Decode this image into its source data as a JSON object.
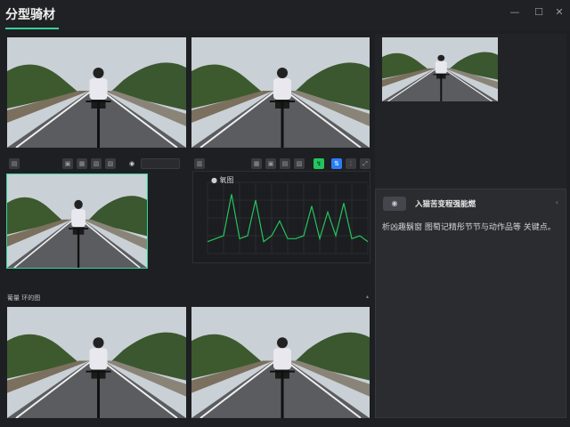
{
  "window": {
    "title": "分型骑材",
    "controls": {
      "minimize": "—",
      "maximize": "☐",
      "close": "✕"
    }
  },
  "toolbar_left": {
    "icons": [
      "save-icon",
      "adjust-icon",
      "crop-icon",
      "flip-icon",
      "rotate-icon"
    ],
    "eye_icon": "eye-icon"
  },
  "toolbar_right": {
    "icons": [
      "tag-icon",
      "grid-icon",
      "crop-icon",
      "image-icon",
      "layers-icon"
    ],
    "active_green": "↯",
    "active_blue": "⇅"
  },
  "chart": {
    "label": "● 氧图"
  },
  "chart_data": {
    "type": "line",
    "title": "",
    "xlabel": "",
    "ylabel": "",
    "x": [
      0,
      0.5,
      1,
      1.5,
      2,
      2.5,
      3,
      3.5,
      4,
      4.5,
      5,
      5.5,
      6,
      6.5,
      7,
      7.5,
      8,
      8.5,
      9,
      9.5,
      10
    ],
    "series": [
      {
        "values": [
          0.2,
          0.25,
          0.3,
          1.0,
          0.25,
          0.3,
          0.9,
          0.2,
          0.3,
          0.55,
          0.25,
          0.25,
          0.3,
          0.8,
          0.25,
          0.7,
          0.3,
          0.85,
          0.25,
          0.3,
          0.2
        ]
      }
    ],
    "ylim": [
      0,
      1.2
    ],
    "grid": true
  },
  "section2": {
    "label": "葡量 环的图",
    "caret": "▴"
  },
  "info_panel": {
    "title": "入猫苦变程强能燃",
    "text": "析凶趣鬍窗 图萄记精彤节节与动作品等 关键点。",
    "close": "‹"
  },
  "colors": {
    "accent": "#34d399",
    "chart_line": "#22c55e",
    "active_blue": "#2b7cf6"
  }
}
